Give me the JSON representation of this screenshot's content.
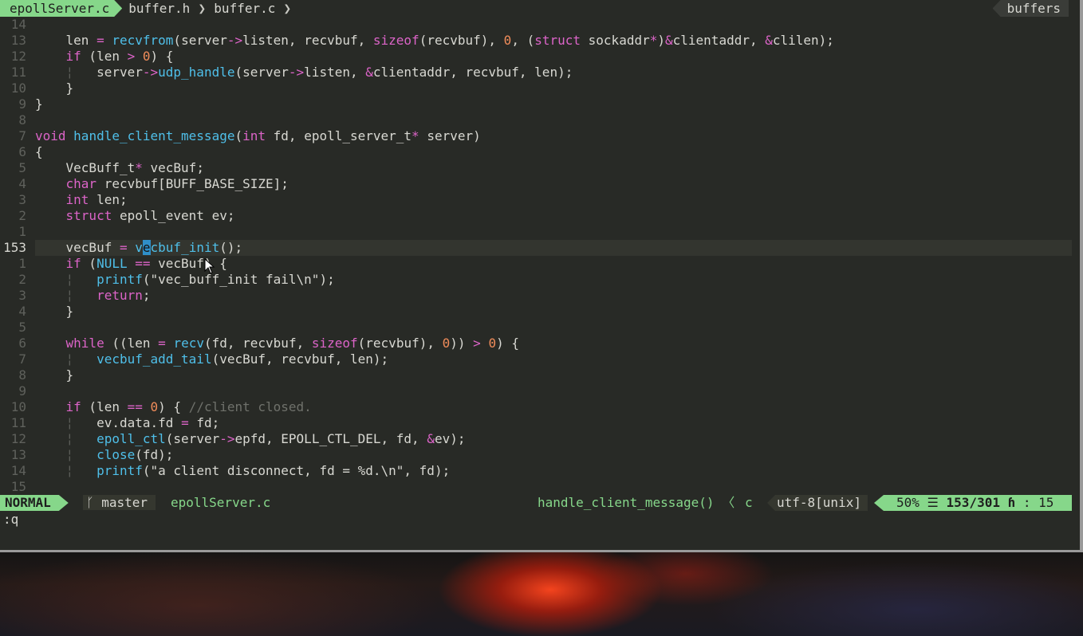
{
  "tabs": {
    "active": "epollServer.c",
    "others": [
      "buffer.h",
      "buffer.c"
    ],
    "right_label": "buffers"
  },
  "editor": {
    "cursor_line_index": 14,
    "lines": [
      {
        "num": "14",
        "code": ""
      },
      {
        "num": "13",
        "code": "    len = recvfrom(server->listen, recvbuf, sizeof(recvbuf), 0, (struct sockaddr*)&clientaddr, &clilen);"
      },
      {
        "num": "12",
        "code": "    if (len > 0) {"
      },
      {
        "num": "11",
        "code": "    ¦   server->udp_handle(server->listen, &clientaddr, recvbuf, len);"
      },
      {
        "num": "10",
        "code": "    }"
      },
      {
        "num": "9",
        "code": "}"
      },
      {
        "num": "8",
        "code": ""
      },
      {
        "num": "7",
        "code": "void handle_client_message(int fd, epoll_server_t* server)"
      },
      {
        "num": "6",
        "code": "{"
      },
      {
        "num": "5",
        "code": "    VecBuff_t* vecBuf;"
      },
      {
        "num": "4",
        "code": "    char recvbuf[BUFF_BASE_SIZE];"
      },
      {
        "num": "3",
        "code": "    int len;"
      },
      {
        "num": "2",
        "code": "    struct epoll_event ev;"
      },
      {
        "num": "1",
        "code": ""
      },
      {
        "num": "153",
        "code": "    vecBuf = vecbuf_init();"
      },
      {
        "num": "1",
        "code": "    if (NULL == vecBuf) {"
      },
      {
        "num": "2",
        "code": "    ¦   printf(\"vec_buff_init fail\\n\");"
      },
      {
        "num": "3",
        "code": "    ¦   return;"
      },
      {
        "num": "4",
        "code": "    }"
      },
      {
        "num": "5",
        "code": ""
      },
      {
        "num": "6",
        "code": "    while ((len = recv(fd, recvbuf, sizeof(recvbuf), 0)) > 0) {"
      },
      {
        "num": "7",
        "code": "    ¦   vecbuf_add_tail(vecBuf, recvbuf, len);"
      },
      {
        "num": "8",
        "code": "    }"
      },
      {
        "num": "9",
        "code": ""
      },
      {
        "num": "10",
        "code": "    if (len == 0) { //client closed."
      },
      {
        "num": "11",
        "code": "    ¦   ev.data.fd = fd;"
      },
      {
        "num": "12",
        "code": "    ¦   epoll_ctl(server->epfd, EPOLL_CTL_DEL, fd, &ev);"
      },
      {
        "num": "13",
        "code": "    ¦   close(fd);"
      },
      {
        "num": "14",
        "code": "    ¦   printf(\"a client disconnect, fd = %d.\\n\", fd);"
      },
      {
        "num": "15",
        "code": ""
      }
    ]
  },
  "statusline": {
    "mode": "NORMAL",
    "branch_icon": "git-branch-icon",
    "branch": "master",
    "file": "epollServer.c",
    "function": "handle_client_message()",
    "filetype": "c",
    "encoding": "utf-8[unix]",
    "percent": "50%",
    "line_pos": "153/301",
    "col_pos": ": 15"
  },
  "cmdline": ":q",
  "colors": {
    "accent_green": "#86d78a",
    "keyword": "#dc64c8",
    "function": "#4fbfe9",
    "number": "#f08c5a",
    "background": "#282a26"
  }
}
